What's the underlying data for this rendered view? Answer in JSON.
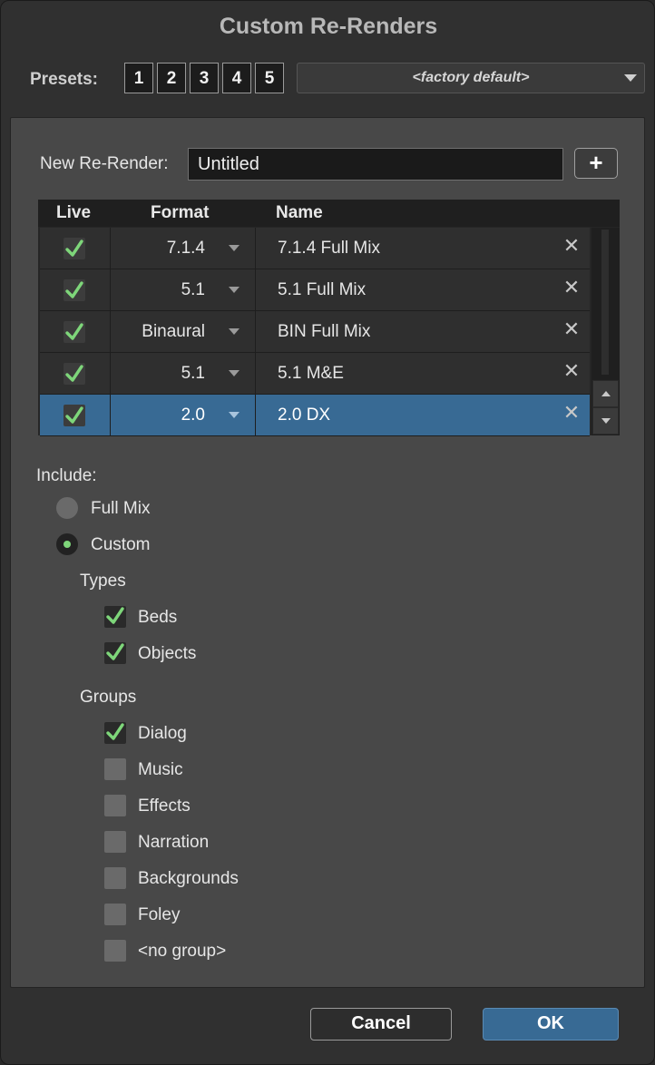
{
  "window": {
    "title": "Custom Re-Renders"
  },
  "presets": {
    "label": "Presets:",
    "buttons": [
      "1",
      "2",
      "3",
      "4",
      "5"
    ],
    "selected": "<factory default>"
  },
  "new_rerender": {
    "label": "New Re-Render:",
    "value": "Untitled",
    "add_label": "+"
  },
  "table": {
    "headers": {
      "live": "Live",
      "format": "Format",
      "name": "Name"
    },
    "rows": [
      {
        "live": true,
        "format": "7.1.4",
        "name": "7.1.4 Full Mix",
        "selected": false
      },
      {
        "live": true,
        "format": "5.1",
        "name": "5.1 Full Mix",
        "selected": false
      },
      {
        "live": true,
        "format": "Binaural",
        "name": "BIN Full Mix",
        "selected": false
      },
      {
        "live": true,
        "format": "5.1",
        "name": "5.1 M&E",
        "selected": false
      },
      {
        "live": true,
        "format": "2.0",
        "name": "2.0 DX",
        "selected": true
      }
    ]
  },
  "include": {
    "label": "Include:",
    "options": [
      {
        "label": "Full Mix",
        "selected": false
      },
      {
        "label": "Custom",
        "selected": true
      }
    ],
    "types": {
      "label": "Types",
      "items": [
        {
          "label": "Beds",
          "checked": true
        },
        {
          "label": "Objects",
          "checked": true
        }
      ]
    },
    "groups": {
      "label": "Groups",
      "items": [
        {
          "label": "Dialog",
          "checked": true
        },
        {
          "label": "Music",
          "checked": false
        },
        {
          "label": "Effects",
          "checked": false
        },
        {
          "label": "Narration",
          "checked": false
        },
        {
          "label": "Backgrounds",
          "checked": false
        },
        {
          "label": "Foley",
          "checked": false
        },
        {
          "label": "<no group>",
          "checked": false
        }
      ]
    }
  },
  "footer": {
    "cancel_label": "Cancel",
    "ok_label": "OK"
  },
  "colors": {
    "accent": "#386a94",
    "check": "#7ed67a",
    "panel": "#484848",
    "window": "#303030"
  }
}
